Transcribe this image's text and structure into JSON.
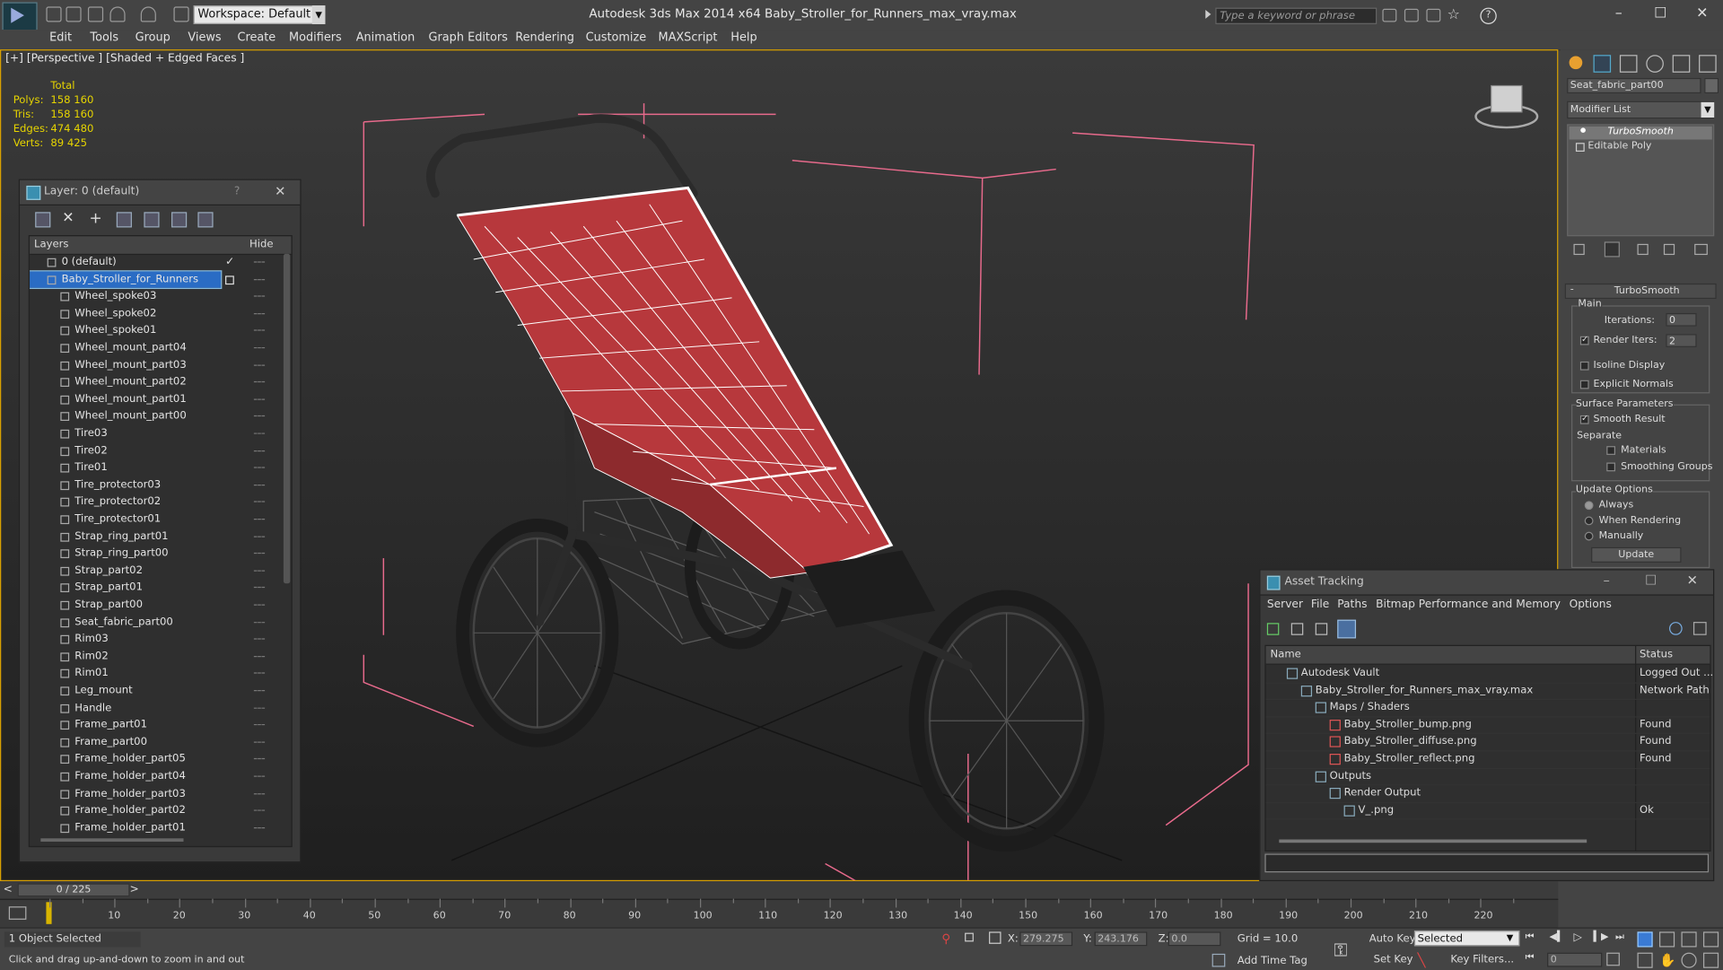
{
  "titlebar": {
    "workspace": "Workspace: Default",
    "app_title": "Autodesk 3ds Max  2014 x64      Baby_Stroller_for_Runners_max_vray.max",
    "search_placeholder": "Type a keyword or phrase"
  },
  "menus": [
    "Edit",
    "Tools",
    "Group",
    "Views",
    "Create",
    "Modifiers",
    "Animation",
    "Graph Editors",
    "Rendering",
    "Customize",
    "MAXScript",
    "Help"
  ],
  "viewport": {
    "label": "[+] [Perspective ] [Shaded + Edged Faces ]",
    "stats": {
      "header": "Total",
      "rows": [
        {
          "k": "Polys:",
          "v": "158 160"
        },
        {
          "k": "Tris:",
          "v": "158 160"
        },
        {
          "k": "Edges:",
          "v": "474 480"
        },
        {
          "k": "Verts:",
          "v": "89 425"
        }
      ]
    }
  },
  "layer_dialog": {
    "title": "Layer: 0 (default)",
    "help": "?",
    "col_layers": "Layers",
    "col_hide": "Hide",
    "rows": [
      {
        "name": "0 (default)",
        "type": "layer"
      },
      {
        "name": "Baby_Stroller_for_Runners",
        "type": "layer-selected"
      },
      {
        "name": "Wheel_spoke03"
      },
      {
        "name": "Wheel_spoke02"
      },
      {
        "name": "Wheel_spoke01"
      },
      {
        "name": "Wheel_mount_part04"
      },
      {
        "name": "Wheel_mount_part03"
      },
      {
        "name": "Wheel_mount_part02"
      },
      {
        "name": "Wheel_mount_part01"
      },
      {
        "name": "Wheel_mount_part00"
      },
      {
        "name": "Tire03"
      },
      {
        "name": "Tire02"
      },
      {
        "name": "Tire01"
      },
      {
        "name": "Tire_protector03"
      },
      {
        "name": "Tire_protector02"
      },
      {
        "name": "Tire_protector01"
      },
      {
        "name": "Strap_ring_part01"
      },
      {
        "name": "Strap_ring_part00"
      },
      {
        "name": "Strap_part02"
      },
      {
        "name": "Strap_part01"
      },
      {
        "name": "Strap_part00"
      },
      {
        "name": "Seat_fabric_part00"
      },
      {
        "name": "Rim03"
      },
      {
        "name": "Rim02"
      },
      {
        "name": "Rim01"
      },
      {
        "name": "Leg_mount"
      },
      {
        "name": "Handle"
      },
      {
        "name": "Frame_part01"
      },
      {
        "name": "Frame_part00"
      },
      {
        "name": "Frame_holder_part05"
      },
      {
        "name": "Frame_holder_part04"
      },
      {
        "name": "Frame_holder_part03"
      },
      {
        "name": "Frame_holder_part02"
      },
      {
        "name": "Frame_holder_part01"
      }
    ]
  },
  "command_panel": {
    "object_name": "Seat_fabric_part00",
    "modifier_list": "Modifier List",
    "stack": [
      "TurboSmooth",
      "Editable Poly"
    ],
    "rollout_title": "TurboSmooth",
    "main": "Main",
    "iterations_label": "Iterations:",
    "iterations_value": "0",
    "render_iters_label": "Render Iters:",
    "render_iters_value": "2",
    "isoline": "Isoline Display",
    "explicit_normals": "Explicit Normals",
    "surface_params": "Surface Parameters",
    "smooth_result": "Smooth Result",
    "separate": "Separate",
    "materials": "Materials",
    "smoothing_groups": "Smoothing Groups",
    "update_options": "Update Options",
    "always": "Always",
    "when_rendering": "When Rendering",
    "manually": "Manually",
    "update_btn": "Update"
  },
  "asset_tracking": {
    "title": "Asset Tracking",
    "menus": [
      "Server",
      "File",
      "Paths",
      "Bitmap Performance and Memory",
      "Options"
    ],
    "col_name": "Name",
    "col_status": "Status",
    "rows": [
      {
        "name": "Autodesk Vault",
        "status": "Logged Out ...",
        "indent": 1
      },
      {
        "name": "Baby_Stroller_for_Runners_max_vray.max",
        "status": "Network Path",
        "indent": 2
      },
      {
        "name": "Maps / Shaders",
        "status": "",
        "indent": 3
      },
      {
        "name": "Baby_Stroller_bump.png",
        "status": "Found",
        "indent": 4
      },
      {
        "name": "Baby_Stroller_diffuse.png",
        "status": "Found",
        "indent": 4
      },
      {
        "name": "Baby_Stroller_reflect.png",
        "status": "Found",
        "indent": 4
      },
      {
        "name": "Outputs",
        "status": "",
        "indent": 3
      },
      {
        "name": "Render Output",
        "status": "",
        "indent": 4
      },
      {
        "name": "V_.png",
        "status": "Ok",
        "indent": 5
      }
    ]
  },
  "timeline": {
    "frame_counter": "0 / 225",
    "ticks": [
      "10",
      "20",
      "30",
      "40",
      "50",
      "60",
      "70",
      "80",
      "90",
      "100",
      "110",
      "120",
      "130",
      "140",
      "150",
      "160",
      "170",
      "180",
      "190",
      "200",
      "210",
      "220"
    ]
  },
  "statusbar": {
    "selected": "1 Object Selected",
    "hint": "Click and drag up-and-down to zoom in and out",
    "x_label": "X:",
    "x_value": "279.275",
    "y_label": "Y:",
    "y_value": "243.176",
    "z_label": "Z:",
    "z_value": "0.0",
    "grid": "Grid = 10.0",
    "add_time_tag": "Add Time Tag",
    "auto_key": "Auto Key",
    "selected_dropdown": "Selected",
    "set_key": "Set Key",
    "key_filters": "Key Filters...",
    "frame_value": "0"
  }
}
